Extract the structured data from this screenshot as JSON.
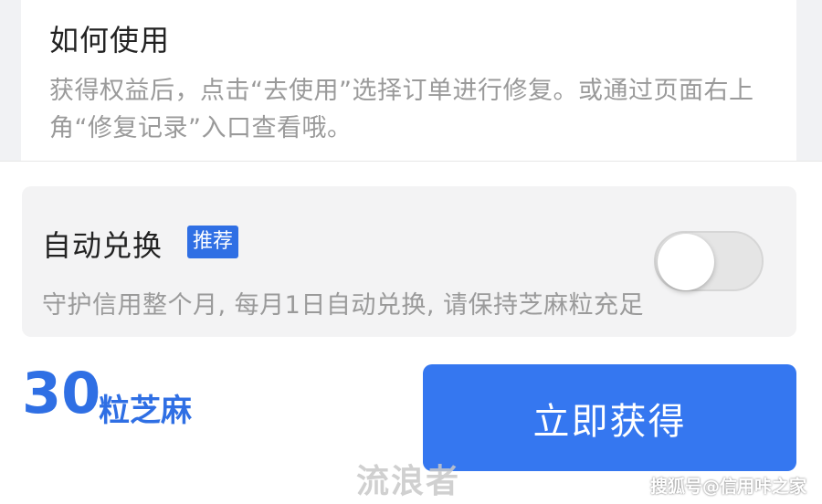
{
  "how_to_use": {
    "title": "如何使用",
    "description": "获得权益后，点击“去使用”选择订单进行修复。或通过页面右上角“修复记录”入口查看哦。"
  },
  "auto_exchange": {
    "title": "自动兑换",
    "badge": "推荐",
    "toggle_on": false,
    "description": "守护信用整个月, 每月1日自动兑换, 请保持芝麻粒充足"
  },
  "price": {
    "amount": "30",
    "unit": "粒芝麻"
  },
  "actions": {
    "get_now_label": "立即获得"
  },
  "watermarks": {
    "center": "流浪者",
    "corner": "搜狐号@信用咔之家"
  },
  "colors": {
    "accent": "#3577f0",
    "badge": "#2f6fe4",
    "title_text": "#222222",
    "secondary_text": "#9a9a9a",
    "card_background": "#f3f3f4",
    "toggle_off": "#e5e5e5"
  }
}
